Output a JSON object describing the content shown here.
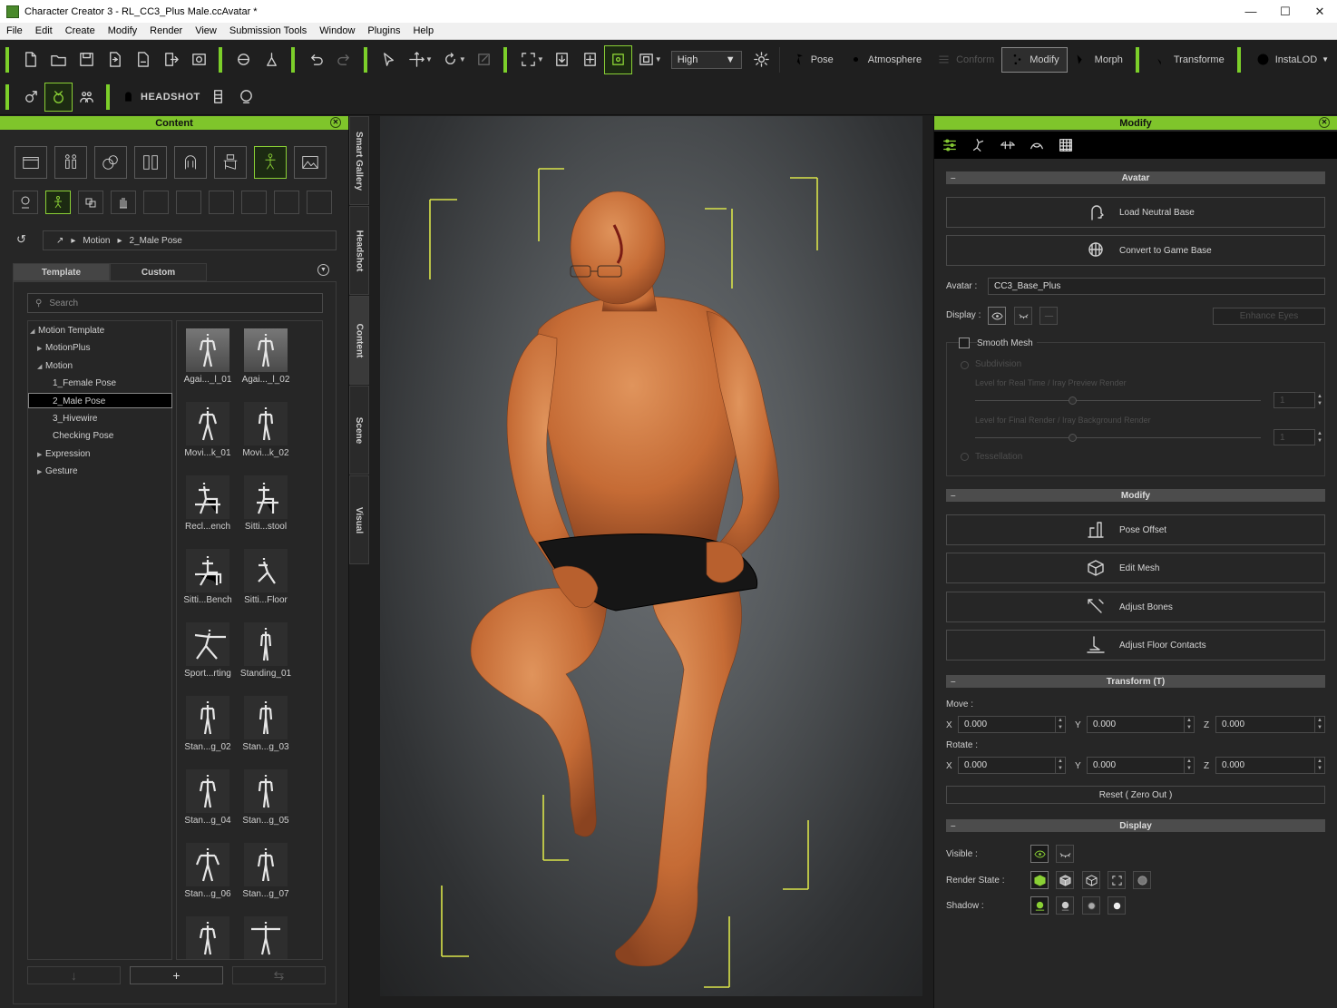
{
  "window": {
    "title": "Character Creator 3 - RL_CC3_Plus Male.ccAvatar *"
  },
  "menu": [
    "File",
    "Edit",
    "Create",
    "Modify",
    "Render",
    "View",
    "Submission Tools",
    "Window",
    "Plugins",
    "Help"
  ],
  "toolbar": {
    "quality": "High",
    "pose_label": "Pose",
    "atmosphere_label": "Atmosphere",
    "conform_label": "Conform",
    "modify_label": "Modify",
    "morph_label": "Morph",
    "transform_label": "Transforme",
    "instalod_label": "InstaLOD",
    "headshot_label": "HEADSHOT"
  },
  "content_panel": {
    "title": "Content",
    "breadcrumb": [
      "Motion",
      "2_Male Pose"
    ],
    "tabs": [
      "Template",
      "Custom"
    ],
    "search_placeholder": "Search",
    "tree": [
      {
        "label": "Motion Template",
        "level": 0,
        "expanded": true
      },
      {
        "label": "MotionPlus",
        "level": 1,
        "expanded": false
      },
      {
        "label": "Motion",
        "level": 1,
        "expanded": true
      },
      {
        "label": "1_Female Pose",
        "level": 2
      },
      {
        "label": "2_Male Pose",
        "level": 2,
        "selected": true
      },
      {
        "label": "3_Hivewire",
        "level": 2
      },
      {
        "label": "Checking Pose",
        "level": 2
      },
      {
        "label": "Expression",
        "level": 1,
        "expanded": false
      },
      {
        "label": "Gesture",
        "level": 1,
        "expanded": false
      }
    ],
    "thumbnails": [
      "Agai..._l_01",
      "Agai..._l_02",
      "Movi...k_01",
      "Movi...k_02",
      "Recl...ench",
      "Sitti...stool",
      "Sitti...Bench",
      "Sitti...Floor",
      "Sport...rting",
      "Standing_01",
      "Stan...g_02",
      "Stan...g_03",
      "Stan...g_04",
      "Stan...g_05",
      "Stan...g_06",
      "Stan...g_07",
      "",
      ""
    ]
  },
  "side_tabs": [
    "Smart Gallery",
    "Headshot",
    "Content",
    "Scene",
    "Visual"
  ],
  "modify_panel": {
    "title": "Modify",
    "avatar_section": "Avatar",
    "load_neutral_base": "Load Neutral Base",
    "convert_to_game_base": "Convert to Game Base",
    "avatar_label": "Avatar :",
    "avatar_value": "CC3_Base_Plus",
    "display_label": "Display :",
    "enhance_eyes": "Enhance Eyes",
    "smooth_mesh": "Smooth Mesh",
    "subdivision": "Subdivision",
    "level_realtime": "Level for Real Time / Iray Preview Render",
    "level_realtime_value": "1",
    "level_final": "Level for Final Render / Iray Background Render",
    "level_final_value": "1",
    "tessellation": "Tessellation",
    "modify_section": "Modify",
    "pose_offset": "Pose Offset",
    "edit_mesh": "Edit Mesh",
    "adjust_bones": "Adjust Bones",
    "adjust_floor_contacts": "Adjust Floor Contacts",
    "transform_section": "Transform  (T)",
    "move_label": "Move :",
    "rotate_label": "Rotate :",
    "x": "X",
    "y": "Y",
    "z": "Z",
    "move": {
      "x": "0.000",
      "y": "0.000",
      "z": "0.000"
    },
    "rotate": {
      "x": "0.000",
      "y": "0.000",
      "z": "0.000"
    },
    "reset": "Reset ( Zero Out )",
    "display_section": "Display",
    "visible_label": "Visible :",
    "render_state_label": "Render State :",
    "shadow_label": "Shadow :"
  },
  "colors": {
    "accent": "#7fc52b",
    "panel": "#262626",
    "viewport": "#55595c"
  }
}
